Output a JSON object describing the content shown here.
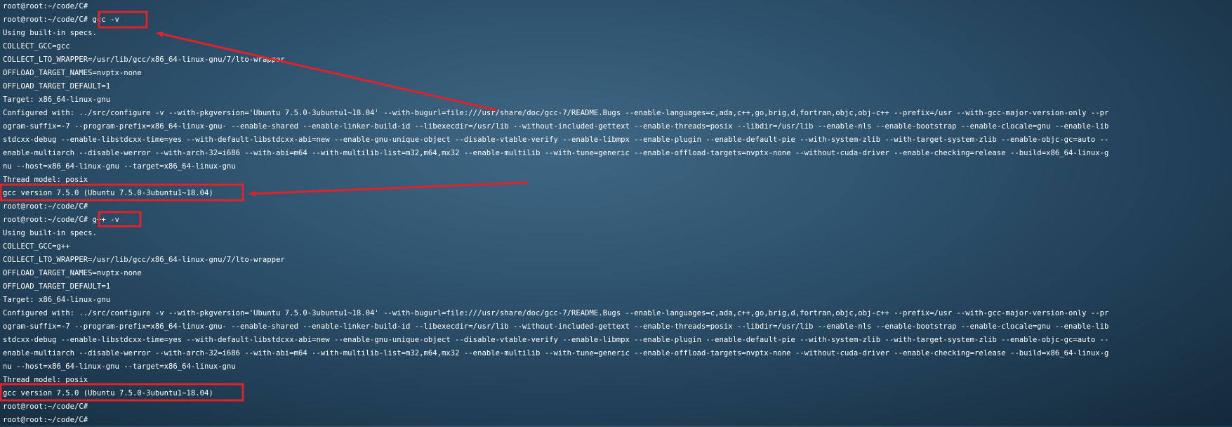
{
  "terminal": {
    "lines": [
      "root@root:~/code/C#",
      "root@root:~/code/C# gcc -v",
      "Using built-in specs.",
      "COLLECT_GCC=gcc",
      "COLLECT_LTO_WRAPPER=/usr/lib/gcc/x86_64-linux-gnu/7/lto-wrapper",
      "OFFLOAD_TARGET_NAMES=nvptx-none",
      "OFFLOAD_TARGET_DEFAULT=1",
      "Target: x86_64-linux-gnu",
      "Configured with: ../src/configure -v --with-pkgversion='Ubuntu 7.5.0-3ubuntu1~18.04' --with-bugurl=file:///usr/share/doc/gcc-7/README.Bugs --enable-languages=c,ada,c++,go,brig,d,fortran,objc,obj-c++ --prefix=/usr --with-gcc-major-version-only --pr",
      "ogram-suffix=-7 --program-prefix=x86_64-linux-gnu- --enable-shared --enable-linker-build-id --libexecdir=/usr/lib --without-included-gettext --enable-threads=posix --libdir=/usr/lib --enable-nls --enable-bootstrap --enable-clocale=gnu --enable-lib",
      "stdcxx-debug --enable-libstdcxx-time=yes --with-default-libstdcxx-abi=new --enable-gnu-unique-object --disable-vtable-verify --enable-libmpx --enable-plugin --enable-default-pie --with-system-zlib --with-target-system-zlib --enable-objc-gc=auto --",
      "enable-multiarch --disable-werror --with-arch-32=i686 --with-abi=m64 --with-multilib-list=m32,m64,mx32 --enable-multilib --with-tune=generic --enable-offload-targets=nvptx-none --without-cuda-driver --enable-checking=release --build=x86_64-linux-g",
      "nu --host=x86_64-linux-gnu --target=x86_64-linux-gnu",
      "Thread model: posix",
      "gcc version 7.5.0 (Ubuntu 7.5.0-3ubuntu1~18.04)",
      "root@root:~/code/C#",
      "root@root:~/code/C# g++ -v",
      "Using built-in specs.",
      "COLLECT_GCC=g++",
      "COLLECT_LTO_WRAPPER=/usr/lib/gcc/x86_64-linux-gnu/7/lto-wrapper",
      "OFFLOAD_TARGET_NAMES=nvptx-none",
      "OFFLOAD_TARGET_DEFAULT=1",
      "Target: x86_64-linux-gnu",
      "Configured with: ../src/configure -v --with-pkgversion='Ubuntu 7.5.0-3ubuntu1~18.04' --with-bugurl=file:///usr/share/doc/gcc-7/README.Bugs --enable-languages=c,ada,c++,go,brig,d,fortran,objc,obj-c++ --prefix=/usr --with-gcc-major-version-only --pr",
      "ogram-suffix=-7 --program-prefix=x86_64-linux-gnu- --enable-shared --enable-linker-build-id --libexecdir=/usr/lib --without-included-gettext --enable-threads=posix --libdir=/usr/lib --enable-nls --enable-bootstrap --enable-clocale=gnu --enable-lib",
      "stdcxx-debug --enable-libstdcxx-time=yes --with-default-libstdcxx-abi=new --enable-gnu-unique-object --disable-vtable-verify --enable-libmpx --enable-plugin --enable-default-pie --with-system-zlib --with-target-system-zlib --enable-objc-gc=auto --",
      "enable-multiarch --disable-werror --with-arch-32=i686 --with-abi=m64 --with-multilib-list=m32,m64,mx32 --enable-multilib --with-tune=generic --enable-offload-targets=nvptx-none --without-cuda-driver --enable-checking=release --build=x86_64-linux-g",
      "nu --host=x86_64-linux-gnu --target=x86_64-linux-gnu",
      "Thread model: posix",
      "gcc version 7.5.0 (Ubuntu 7.5.0-3ubuntu1~18.04)",
      "root@root:~/code/C#",
      "root@root:~/code/C#"
    ]
  },
  "colors": {
    "text": "#ffffff",
    "annotation": "#e0222a",
    "background": "#2f5470"
  }
}
